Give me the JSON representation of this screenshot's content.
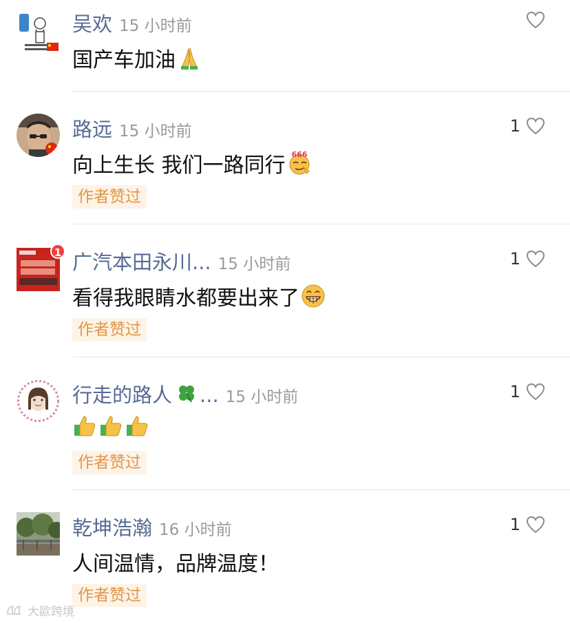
{
  "comments": [
    {
      "name": "吴欢",
      "time": "15 小时前",
      "text": "国产车加油",
      "emoji": "folded-hands",
      "like_count": "",
      "author_liked": ""
    },
    {
      "name": "路远",
      "time": "15 小时前",
      "text": "向上生长 我们一路同行",
      "emoji": "666-face",
      "like_count": "1",
      "author_liked": "作者赞过"
    },
    {
      "name": "广汽本田永川...",
      "time": "15 小时前",
      "text": "看得我眼睛水都要出来了",
      "emoji": "grinning-face",
      "like_count": "1",
      "author_liked": "作者赞过",
      "avatar_badge": "1"
    },
    {
      "name": "行走的路人",
      "name_suffix": "...",
      "name_emoji": "four-leaf-clover",
      "time": "15 小时前",
      "text": "",
      "emoji": "thumbs-up x3",
      "like_count": "1",
      "author_liked": "作者赞过"
    },
    {
      "name": "乾坤浩瀚",
      "time": "16 小时前",
      "text": "人间温情，品牌温度！",
      "like_count": "1",
      "author_liked": "作者赞过"
    }
  ],
  "watermark": "大歐跨境",
  "colors": {
    "name": "#576b95",
    "time": "#9a9a9a",
    "badge_bg": "#fdf3e7",
    "badge_text": "#e0964a",
    "heart": "#8a8a8a"
  }
}
